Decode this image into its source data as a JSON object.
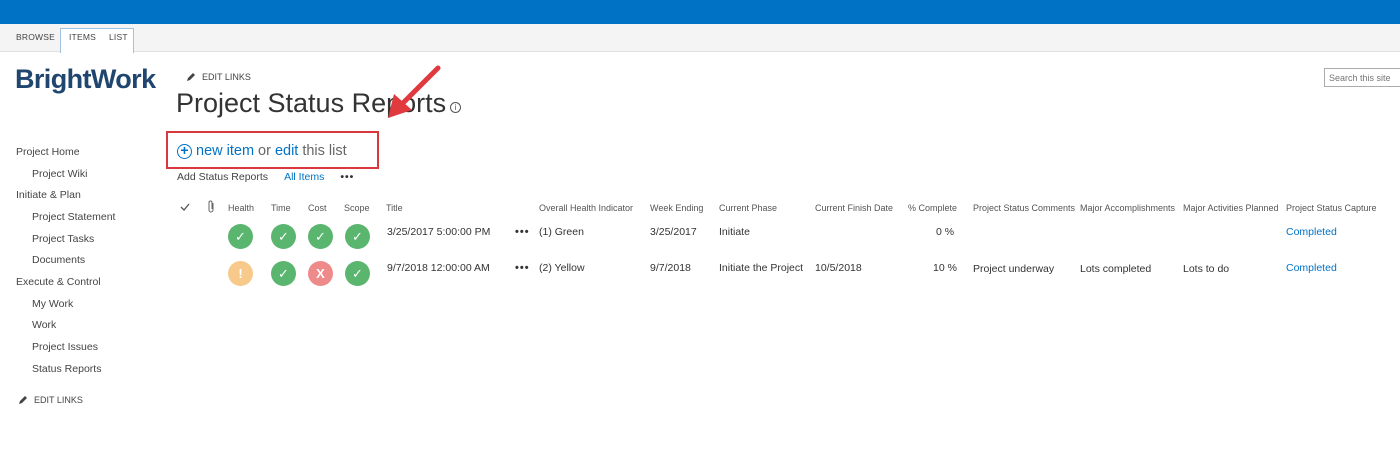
{
  "ribbon": {
    "tabs": [
      "BROWSE",
      "ITEMS",
      "LIST"
    ]
  },
  "logo": "BrightWork",
  "edit_links_label": "EDIT LINKS",
  "page": {
    "title": "Project Status Reports",
    "info_icon": "i"
  },
  "search": {
    "placeholder": "Search this site"
  },
  "nav": {
    "items": [
      "Project Home",
      "Project Wiki",
      "Initiate & Plan",
      "Project Statement",
      "Project Tasks",
      "Documents",
      "Execute & Control",
      "My Work",
      "Work",
      "Project Issues",
      "Status Reports"
    ]
  },
  "toolbar": {
    "new_item": "new item",
    "or": "or",
    "edit": "edit",
    "this_list": "this list",
    "views": [
      "Add Status Reports",
      "All Items"
    ],
    "more": "•••"
  },
  "table": {
    "headers": [
      "Health",
      "Time",
      "Cost",
      "Scope",
      "Title",
      "Overall Health Indicator",
      "Week Ending",
      "Current Phase",
      "Current Finish Date",
      "% Complete",
      "Project Status Comments",
      "Major Accomplishments",
      "Major Activities Planned",
      "Project Status Capture"
    ],
    "rows": [
      {
        "health": "✓",
        "time": "✓",
        "cost": "✓",
        "scope": "✓",
        "title": "3/25/2017 5:00:00 PM",
        "more": "•••",
        "overall": "(1) Green",
        "week_ending": "3/25/2017",
        "phase": "Initiate",
        "finish_date": "",
        "complete": "0 %",
        "comments": "",
        "accomplishments": "",
        "activities": "",
        "capture": "Completed"
      },
      {
        "health": "!",
        "time": "✓",
        "cost": "X",
        "scope": "✓",
        "title": "9/7/2018 12:00:00 AM",
        "more": "•••",
        "overall": "(2) Yellow",
        "week_ending": "9/7/2018",
        "phase": "Initiate the Project",
        "finish_date": "10/5/2018",
        "complete": "10 %",
        "comments": "Project underway",
        "accomplishments": "Lots completed",
        "activities": "Lots to do",
        "capture": "Completed"
      }
    ]
  },
  "colors": {
    "suite_bar": "#0072c6",
    "link": "#0072c6",
    "status_green": "#5ab56f",
    "status_amber": "#f7c98b",
    "status_red": "#ef8a8a",
    "highlight_box": "#d9383e"
  }
}
